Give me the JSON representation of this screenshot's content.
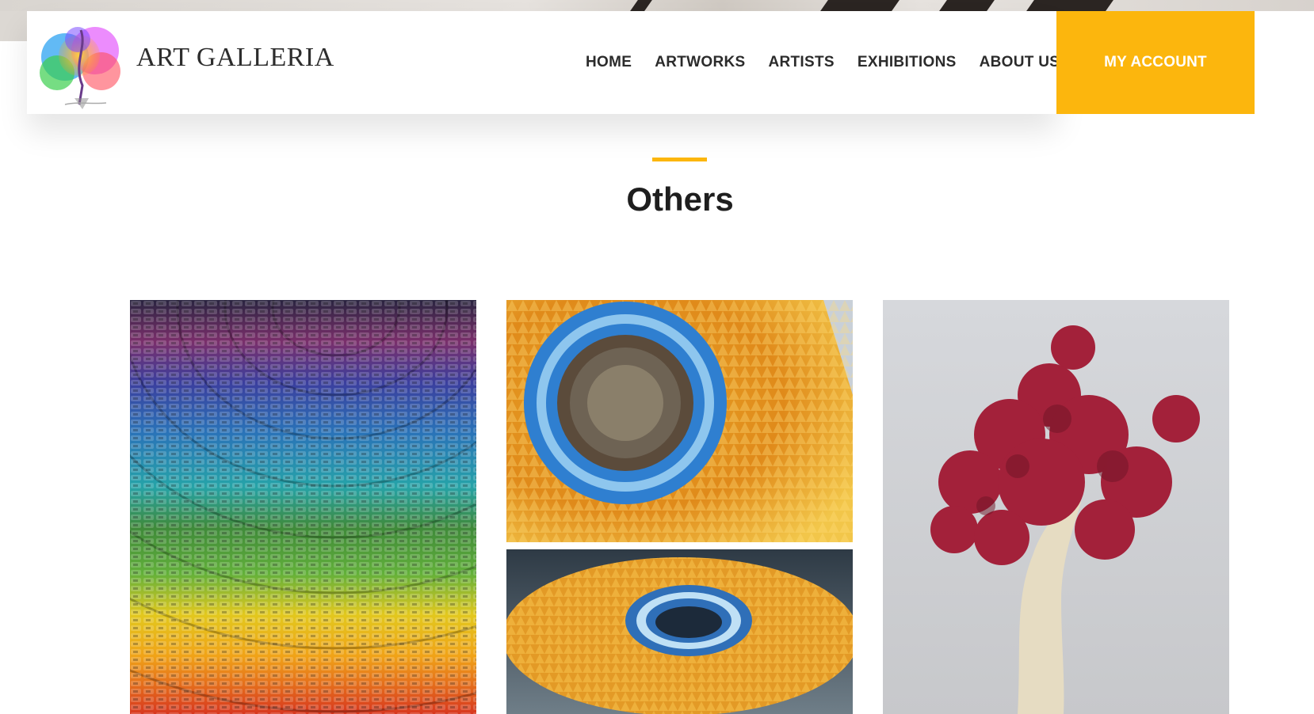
{
  "brand": {
    "name": "ART GALLERIA",
    "logo_icon": "paint-splash-logo"
  },
  "nav": {
    "items": [
      {
        "label": "HOME"
      },
      {
        "label": "ARTWORKS"
      },
      {
        "label": "ARTISTS"
      },
      {
        "label": "EXHIBITIONS"
      },
      {
        "label": "ABOUT US"
      }
    ],
    "account_label": "MY ACCOUNT"
  },
  "section": {
    "title": "Others"
  },
  "gallery": {
    "items": [
      {
        "subject": "toy-car-rainbow-mosaic"
      },
      {
        "subject": "colored-pencil-sunflower-sculpture"
      },
      {
        "subject": "pencil-bowl-sculpture"
      },
      {
        "subject": "matchstick-tree-sculpture"
      }
    ]
  },
  "colors": {
    "accent": "#fcb60d",
    "text_dark": "#2b2b2b",
    "background": "#ffffff"
  }
}
